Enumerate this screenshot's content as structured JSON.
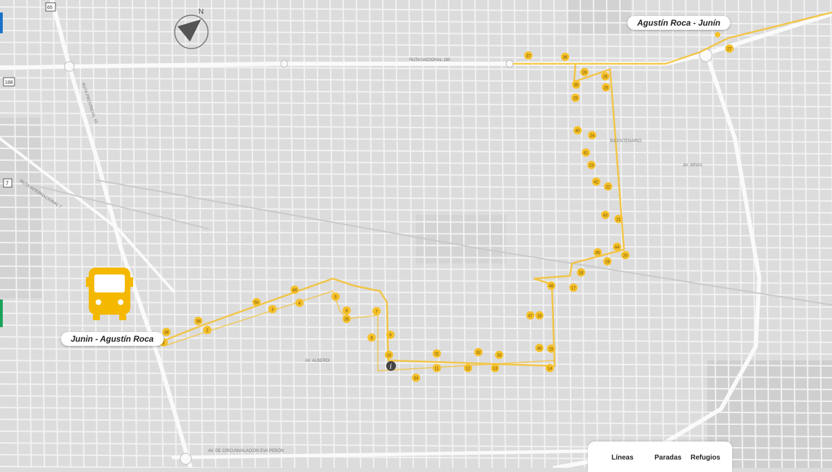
{
  "route": {
    "start_label": "Junin - Agustín Roca",
    "end_label": "Agustín Roca - Junín",
    "color": "#f5c02a",
    "stops": [
      "1",
      "2",
      "3",
      "4",
      "5",
      "6",
      "7",
      "8",
      "9",
      "10",
      "11",
      "12",
      "13",
      "14",
      "15",
      "16",
      "17",
      "18",
      "19",
      "20",
      "21",
      "22",
      "23",
      "24",
      "25",
      "26",
      "27",
      "28",
      "29",
      "30",
      "31",
      "32",
      "33",
      "34",
      "35",
      "36",
      "37",
      "38",
      "39",
      "40",
      "41",
      "42",
      "43",
      "44",
      "45",
      "46",
      "47",
      "48",
      "49",
      "50"
    ]
  },
  "map_labels": {
    "route_ruta_nacional": "RUTA NACIONAL 188",
    "route_ruta_provincial": "RUTA PROVINCIAL 65",
    "route_internacional": "RUTA INTERNACIONAL 7",
    "avenue_circunvalacion": "AV. DE CIRCUNVALACIÓN EVA PERÓN",
    "street_bicentenario": "BICENTENARIO",
    "street_arias": "AV. ARIAS",
    "street_alberdi": "AV. ALBERDI",
    "shield_188": "188",
    "shield_65": "65",
    "shield_7": "7",
    "north": "N"
  },
  "legend": {
    "lines": "Líneas",
    "stops": "Paradas",
    "shelters": "Refugios"
  },
  "icons": {
    "bus": "bus-icon",
    "info": "info-icon",
    "compass": "north-arrow-icon"
  }
}
